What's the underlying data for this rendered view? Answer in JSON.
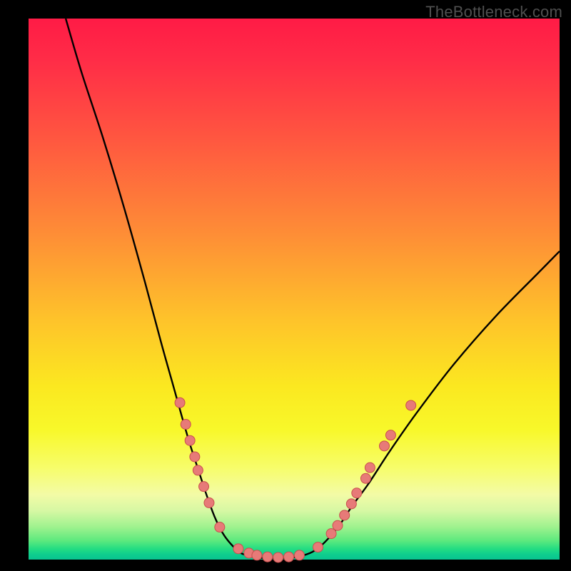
{
  "watermark": "TheBottleneck.com",
  "chart_data": {
    "type": "line",
    "title": "",
    "xlabel": "",
    "ylabel": "",
    "xlim": [
      0,
      100
    ],
    "ylim": [
      0,
      100
    ],
    "series": [
      {
        "name": "bottleneck-curve",
        "x": [
          7,
          10,
          14,
          18,
          22,
          25,
          27,
          29,
          30.5,
          32,
          33.5,
          35,
          36.5,
          38,
          40,
          43,
          47,
          50,
          53,
          55,
          57,
          59,
          61,
          64,
          68,
          73,
          80,
          88,
          96,
          100
        ],
        "y": [
          100,
          90,
          78,
          65,
          51,
          40,
          33,
          26,
          21,
          16.5,
          12,
          8,
          5,
          3,
          1.2,
          0.4,
          0.2,
          0.4,
          1.2,
          2.5,
          4.5,
          7,
          10,
          14,
          20,
          27,
          36,
          45,
          53,
          57
        ]
      }
    ],
    "markers": [
      {
        "x": 28.5,
        "y": 29
      },
      {
        "x": 29.6,
        "y": 25
      },
      {
        "x": 30.4,
        "y": 22
      },
      {
        "x": 31.3,
        "y": 19
      },
      {
        "x": 31.9,
        "y": 16.5
      },
      {
        "x": 33.0,
        "y": 13.5
      },
      {
        "x": 34.0,
        "y": 10.5
      },
      {
        "x": 36.0,
        "y": 6
      },
      {
        "x": 39.5,
        "y": 2
      },
      {
        "x": 41.5,
        "y": 1.2
      },
      {
        "x": 43.0,
        "y": 0.8
      },
      {
        "x": 45.0,
        "y": 0.5
      },
      {
        "x": 47.0,
        "y": 0.4
      },
      {
        "x": 49.0,
        "y": 0.5
      },
      {
        "x": 51.0,
        "y": 0.8
      },
      {
        "x": 54.5,
        "y": 2.3
      },
      {
        "x": 57.0,
        "y": 4.8
      },
      {
        "x": 58.2,
        "y": 6.3
      },
      {
        "x": 59.5,
        "y": 8.2
      },
      {
        "x": 60.8,
        "y": 10.3
      },
      {
        "x": 61.8,
        "y": 12.3
      },
      {
        "x": 63.5,
        "y": 15
      },
      {
        "x": 64.3,
        "y": 17
      },
      {
        "x": 67.0,
        "y": 21
      },
      {
        "x": 68.2,
        "y": 23
      },
      {
        "x": 72.0,
        "y": 28.5
      }
    ],
    "marker_style": {
      "fill": "#e77a78",
      "stroke": "#c94f4d",
      "r": 7
    },
    "curve_style": {
      "stroke": "#000000",
      "width": 2.4
    }
  }
}
